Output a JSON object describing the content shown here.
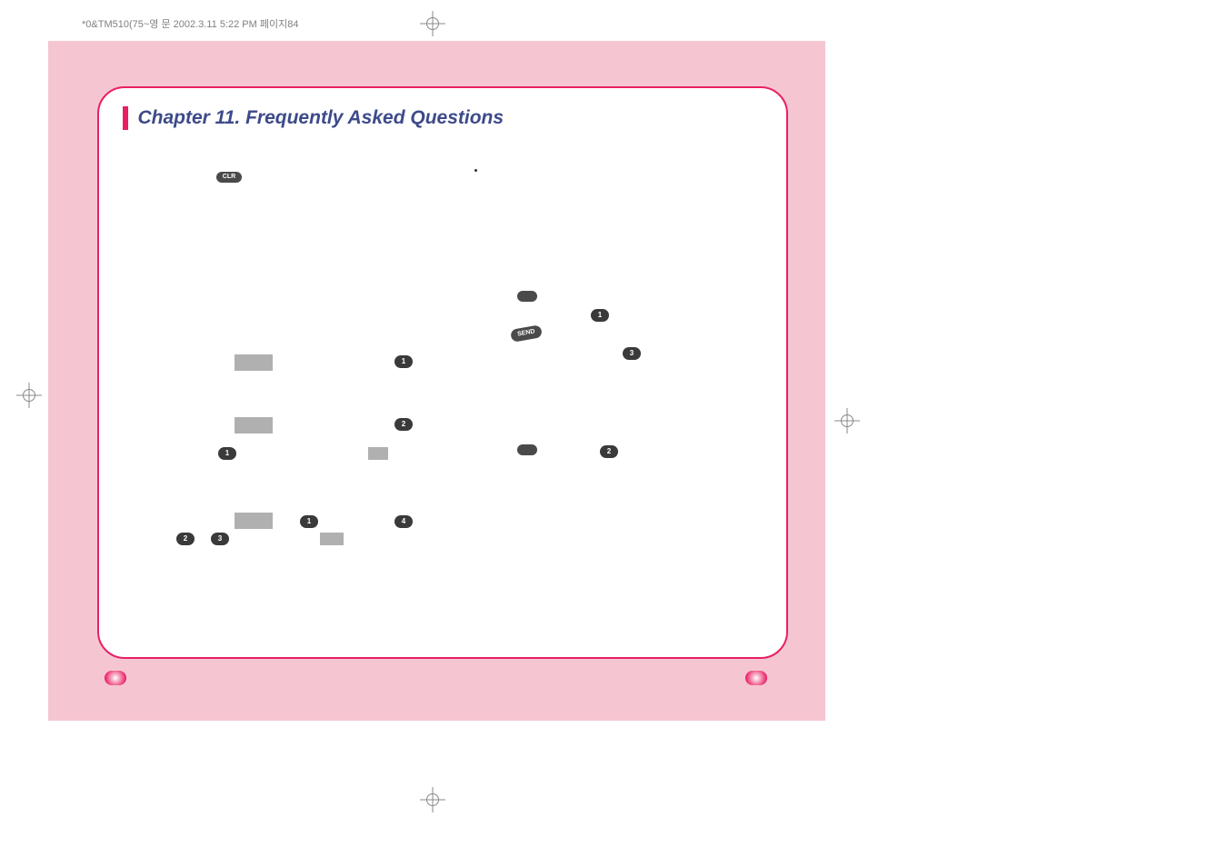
{
  "header": "*0&TM510(75~영 문  2002.3.11 5:22 PM  페이지84",
  "chapter_title": "Chapter 11. Frequently Asked Questions",
  "pills": {
    "clr": "CLR",
    "send": "SEND"
  },
  "nums": {
    "n1": "1",
    "n2": "2",
    "n3": "1",
    "n4": "1",
    "n5": "4",
    "n6": "2",
    "n7": "3",
    "n8": "1",
    "n9": "3",
    "n10": "2"
  }
}
